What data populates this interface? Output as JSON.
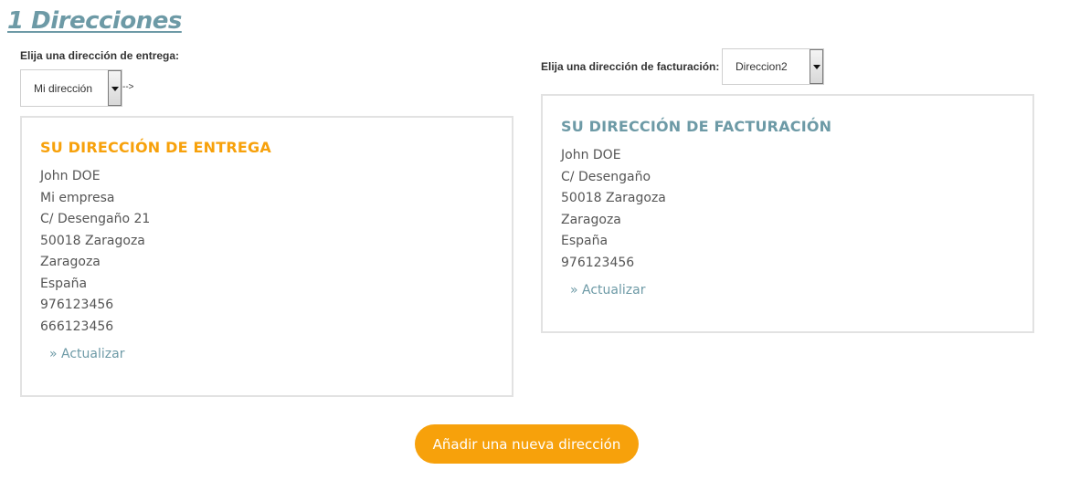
{
  "header": {
    "step_title": "1 Direcciones"
  },
  "delivery": {
    "label": "Elija una dirección de entrega:",
    "selected": "Mi dirección",
    "arrow_text": "-->",
    "heading": "SU DIRECCIÓN DE ENTREGA",
    "lines": [
      "John DOE",
      "Mi empresa",
      "C/ Desengaño 21",
      "50018 Zaragoza",
      "Zaragoza",
      "España",
      "976123456",
      "666123456"
    ],
    "update_link": "» Actualizar"
  },
  "billing": {
    "label": "Elija una dirección de facturación:",
    "selected": "Direccion2",
    "heading": "SU DIRECCIÓN DE FACTURACIÓN",
    "lines": [
      "John DOE",
      "C/ Desengaño",
      "50018 Zaragoza",
      "Zaragoza",
      "España",
      "976123456"
    ],
    "update_link": "» Actualizar"
  },
  "actions": {
    "add_address_label": "Añadir una nueva dirección"
  },
  "colors": {
    "accent_orange": "#f7a10b",
    "accent_teal": "#6d9aa6",
    "box_border": "#e2e2e2",
    "text": "#555555"
  },
  "icons": {
    "select_arrow": "chevron-down-icon"
  }
}
